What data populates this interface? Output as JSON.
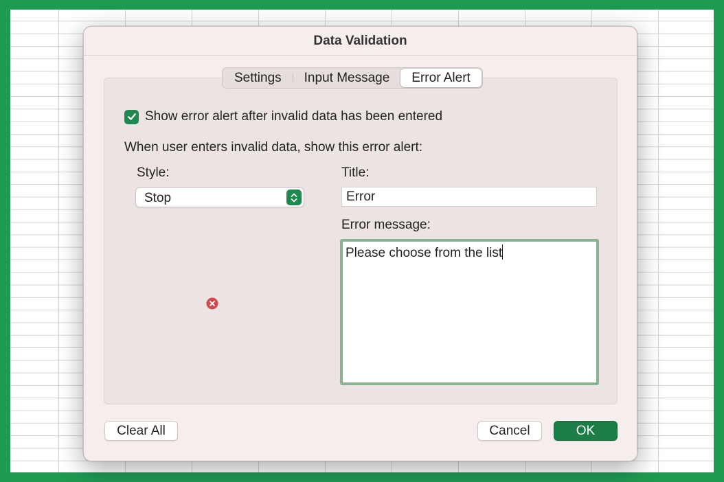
{
  "dialog": {
    "title": "Data Validation",
    "tabs": [
      {
        "label": "Settings",
        "active": false
      },
      {
        "label": "Input Message",
        "active": false
      },
      {
        "label": "Error Alert",
        "active": true
      }
    ],
    "show_alert_label": "Show error alert after invalid data has been entered",
    "show_alert_checked": true,
    "instruction": "When user enters invalid data, show this error alert:",
    "style_label": "Style:",
    "style_value": "Stop",
    "style_icon": "stop-icon",
    "title_label": "Title:",
    "title_value": "Error",
    "message_label": "Error message:",
    "message_value": "Please choose from the list",
    "buttons": {
      "clear_all": "Clear All",
      "cancel": "Cancel",
      "ok": "OK"
    }
  },
  "colors": {
    "accent": "#1f8a4f",
    "frame": "#1f9a52",
    "stop_icon": "#cf4a4f"
  }
}
